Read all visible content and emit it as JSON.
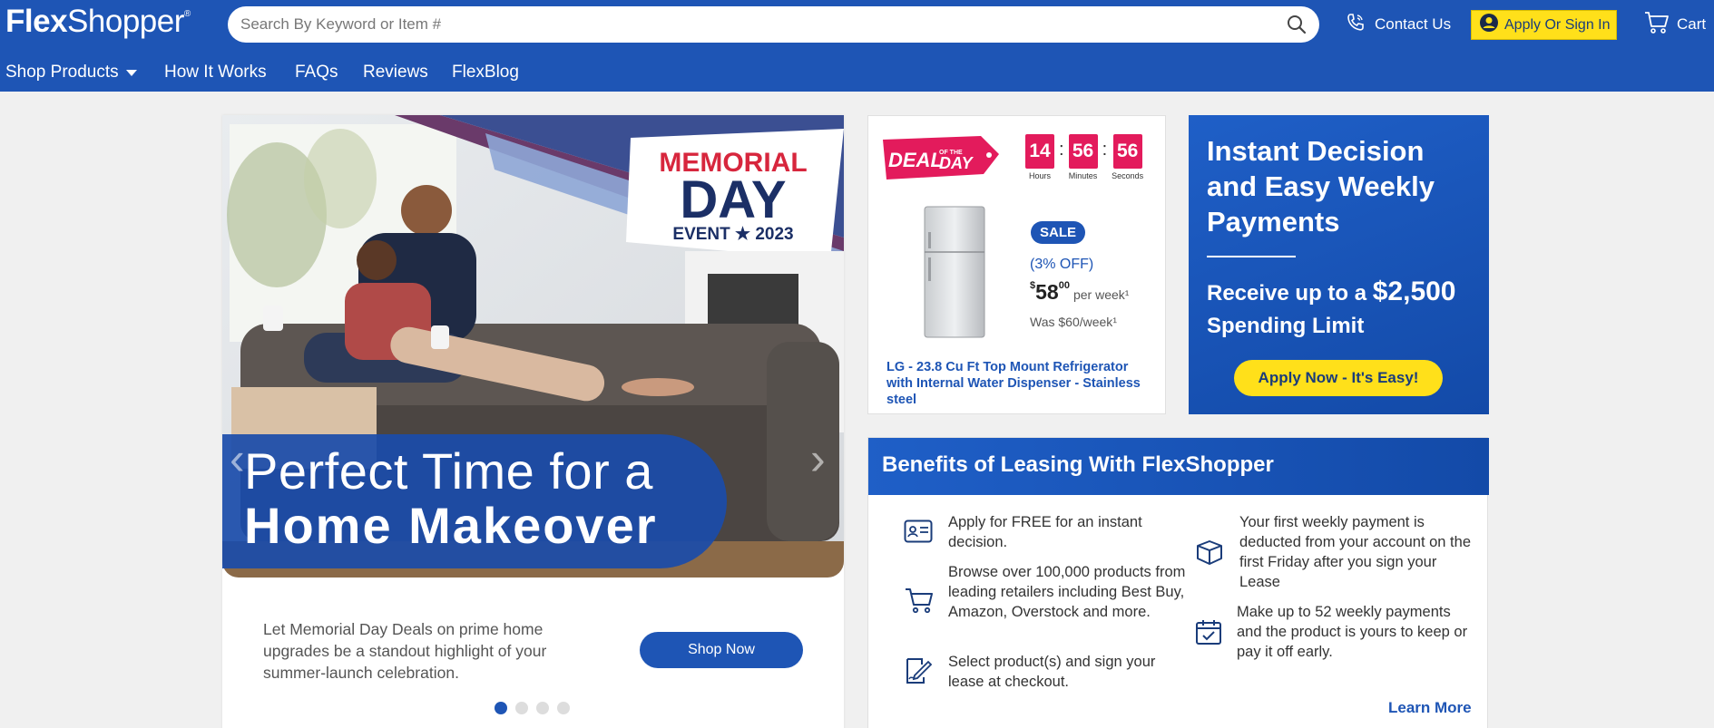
{
  "header": {
    "logo_bold": "Flex",
    "logo_rest": "Shopper",
    "logo_mark": "®",
    "search_placeholder": "Search By Keyword or Item #",
    "contact_label": "Contact Us",
    "signin_label": "Apply Or Sign In",
    "cart_label": "Cart"
  },
  "nav": {
    "items": [
      "Shop Products",
      "How It Works",
      "FAQs",
      "Reviews",
      "FlexBlog"
    ]
  },
  "hero": {
    "badge_top": "MEMORIAL",
    "badge_mid": "DAY",
    "badge_bottom": "EVENT ★ 2023",
    "headline_1": "Perfect Time for a",
    "headline_2": "Home Makeover",
    "description": "Let Memorial Day Deals on prime home upgrades be a standout highlight of your summer-launch celebration.",
    "cta": "Shop Now",
    "slide_count": 4,
    "active_slide": 1
  },
  "deal": {
    "badge": "DEAL",
    "badge_small": "OF THE",
    "badge_end": "DAY",
    "timer": [
      {
        "value": "14",
        "label": "Hours"
      },
      {
        "value": "56",
        "label": "Minutes"
      },
      {
        "value": "56",
        "label": "Seconds"
      }
    ],
    "timer_sep": ":",
    "sale_label": "SALE",
    "discount": "(3% OFF)",
    "currency": "$",
    "price_whole": "58",
    "price_cents": "00",
    "price_unit": "per week",
    "price_mark": "¹",
    "was": "Was $60/week",
    "was_mark": "¹",
    "title": "LG - 23.8 Cu Ft Top Mount Refrigerator with Internal Water Dispenser - Stainless steel"
  },
  "instant": {
    "heading": "Instant Decision and Easy Weekly Payments",
    "receive_pre": "Receive up to a ",
    "amount": "$2,500",
    "receive_post": "Spending Limit",
    "cta": "Apply Now - It's Easy!"
  },
  "benefits": {
    "heading": "Benefits of Leasing With FlexShopper",
    "items": [
      {
        "icon": "id-card-icon",
        "text": "Apply for FREE for an instant decision."
      },
      {
        "icon": "cart-icon",
        "text": "Browse over 100,000 products from leading retailers including Best Buy, Amazon, Overstock and more."
      },
      {
        "icon": "sign-document-icon",
        "text": "Select product(s) and sign your lease at checkout."
      },
      {
        "icon": "box-icon",
        "text": "Your first weekly payment is deducted from your account on the first Friday after you sign your Lease"
      },
      {
        "icon": "calendar-check-icon",
        "text": "Make up to 52 weekly payments and the product is yours to keep or pay it off early."
      }
    ],
    "learn_more": "Learn More"
  },
  "colors": {
    "brand_blue": "#1e55b5",
    "yellow": "#ffe01a",
    "deal_red": "#e31b5c",
    "background": "#f0f0f0"
  }
}
